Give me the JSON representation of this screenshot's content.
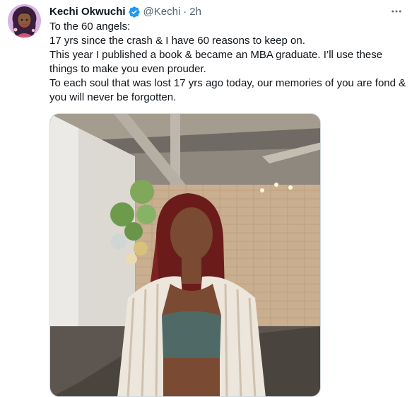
{
  "tweet": {
    "author": {
      "name": "Kechi Okwuchi",
      "handle": "@Kechi",
      "verified": true,
      "avatar_icon": "profile-avatar-illustration"
    },
    "separator": "·",
    "time": "2h",
    "more_icon": "more-horizontal-icon",
    "text_lines": [
      "To the 60 angels:",
      "17 yrs since the crash & I have 60 reasons to keep on.",
      "This year I published a book & became an MBA graduate. I’ll use these things to make you even prouder.",
      "To each soul that was lost 17 yrs ago today, our memories of you are fond & you will never be forgotten."
    ],
    "media": {
      "type": "photo",
      "icon": "photo-image"
    }
  },
  "colors": {
    "text_primary": "#0f1419",
    "text_secondary": "#536471",
    "verified_blue": "#1d9bf0",
    "border": "#cfd9de"
  }
}
